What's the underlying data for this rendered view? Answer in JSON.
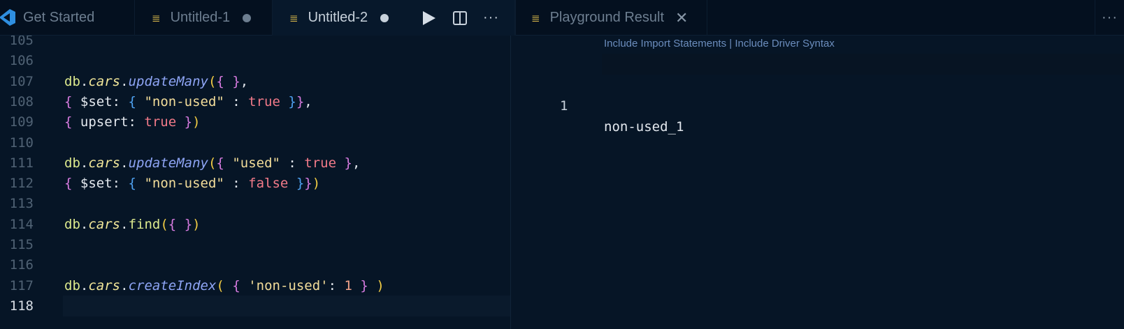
{
  "tabs": [
    {
      "label": "Get Started"
    },
    {
      "label": "Untitled-1"
    },
    {
      "label": "Untitled-2"
    },
    {
      "label": "Playground Result"
    }
  ],
  "icons": {
    "file": "≣",
    "close": "✕",
    "more": "···"
  },
  "colors": {
    "background": "#061526",
    "tabbar": "#04101f",
    "accent_file_icon": "#d9b84a"
  },
  "editor": {
    "lines": [
      {
        "n": "105",
        "tokens": []
      },
      {
        "n": "106",
        "tokens": []
      },
      {
        "n": "107",
        "tokens": [
          {
            "t": "db",
            "c": "id-db"
          },
          {
            "t": ".",
            "c": "punc"
          },
          {
            "t": "cars",
            "c": "prop"
          },
          {
            "t": ".",
            "c": "punc"
          },
          {
            "t": "updateMany",
            "c": "fn"
          },
          {
            "t": "(",
            "c": "b1"
          },
          {
            "t": "{",
            "c": "b2"
          },
          {
            "t": " ",
            "c": "punc"
          },
          {
            "t": "}",
            "c": "b2"
          },
          {
            "t": ",",
            "c": "punc"
          }
        ]
      },
      {
        "n": "108",
        "tokens": [
          {
            "t": "{",
            "c": "b2"
          },
          {
            "t": " $set: ",
            "c": "key"
          },
          {
            "t": "{",
            "c": "b3"
          },
          {
            "t": " ",
            "c": "punc"
          },
          {
            "t": "\"non-used\"",
            "c": "str"
          },
          {
            "t": " : ",
            "c": "punc"
          },
          {
            "t": "true",
            "c": "kw"
          },
          {
            "t": " ",
            "c": "punc"
          },
          {
            "t": "}",
            "c": "b3"
          },
          {
            "t": "}",
            "c": "b2"
          },
          {
            "t": ",",
            "c": "punc"
          }
        ]
      },
      {
        "n": "109",
        "tokens": [
          {
            "t": "{",
            "c": "b2"
          },
          {
            "t": " upsert: ",
            "c": "key"
          },
          {
            "t": "true",
            "c": "kw"
          },
          {
            "t": " ",
            "c": "punc"
          },
          {
            "t": "}",
            "c": "b2"
          },
          {
            "t": ")",
            "c": "b1"
          }
        ]
      },
      {
        "n": "110",
        "tokens": []
      },
      {
        "n": "111",
        "tokens": [
          {
            "t": "db",
            "c": "id-db"
          },
          {
            "t": ".",
            "c": "punc"
          },
          {
            "t": "cars",
            "c": "prop"
          },
          {
            "t": ".",
            "c": "punc"
          },
          {
            "t": "updateMany",
            "c": "fn"
          },
          {
            "t": "(",
            "c": "b1"
          },
          {
            "t": "{",
            "c": "b2"
          },
          {
            "t": " ",
            "c": "punc"
          },
          {
            "t": "\"used\"",
            "c": "str"
          },
          {
            "t": " : ",
            "c": "punc"
          },
          {
            "t": "true",
            "c": "kw"
          },
          {
            "t": " ",
            "c": "punc"
          },
          {
            "t": "}",
            "c": "b2"
          },
          {
            "t": ",",
            "c": "punc"
          }
        ]
      },
      {
        "n": "112",
        "tokens": [
          {
            "t": "{",
            "c": "b2"
          },
          {
            "t": " $set: ",
            "c": "key"
          },
          {
            "t": "{",
            "c": "b3"
          },
          {
            "t": " ",
            "c": "punc"
          },
          {
            "t": "\"non-used\"",
            "c": "str"
          },
          {
            "t": " : ",
            "c": "punc"
          },
          {
            "t": "false",
            "c": "kw"
          },
          {
            "t": " ",
            "c": "punc"
          },
          {
            "t": "}",
            "c": "b3"
          },
          {
            "t": "}",
            "c": "b2"
          },
          {
            "t": ")",
            "c": "b1"
          }
        ]
      },
      {
        "n": "113",
        "tokens": []
      },
      {
        "n": "114",
        "tokens": [
          {
            "t": "db",
            "c": "id-db"
          },
          {
            "t": ".",
            "c": "punc"
          },
          {
            "t": "cars",
            "c": "prop"
          },
          {
            "t": ".",
            "c": "punc"
          },
          {
            "t": "find",
            "c": "fnp"
          },
          {
            "t": "(",
            "c": "b1"
          },
          {
            "t": "{",
            "c": "b2"
          },
          {
            "t": " ",
            "c": "punc"
          },
          {
            "t": "}",
            "c": "b2"
          },
          {
            "t": ")",
            "c": "b1"
          }
        ]
      },
      {
        "n": "115",
        "tokens": []
      },
      {
        "n": "116",
        "tokens": []
      },
      {
        "n": "117",
        "tokens": [
          {
            "t": "db",
            "c": "id-db"
          },
          {
            "t": ".",
            "c": "punc"
          },
          {
            "t": "cars",
            "c": "prop"
          },
          {
            "t": ".",
            "c": "punc"
          },
          {
            "t": "createIndex",
            "c": "fn"
          },
          {
            "t": "(",
            "c": "b1"
          },
          {
            "t": " ",
            "c": "punc"
          },
          {
            "t": "{",
            "c": "b2"
          },
          {
            "t": " ",
            "c": "punc"
          },
          {
            "t": "'non-used'",
            "c": "str"
          },
          {
            "t": ": ",
            "c": "punc"
          },
          {
            "t": "1",
            "c": "num"
          },
          {
            "t": " ",
            "c": "punc"
          },
          {
            "t": "}",
            "c": "b2"
          },
          {
            "t": " ",
            "c": "punc"
          },
          {
            "t": ")",
            "c": "b1"
          }
        ]
      },
      {
        "n": "118",
        "tokens": [],
        "current": true
      }
    ]
  },
  "result": {
    "codelens": "Include Import Statements | Include Driver Syntax",
    "line_number": "1",
    "value": "non-used_1"
  }
}
